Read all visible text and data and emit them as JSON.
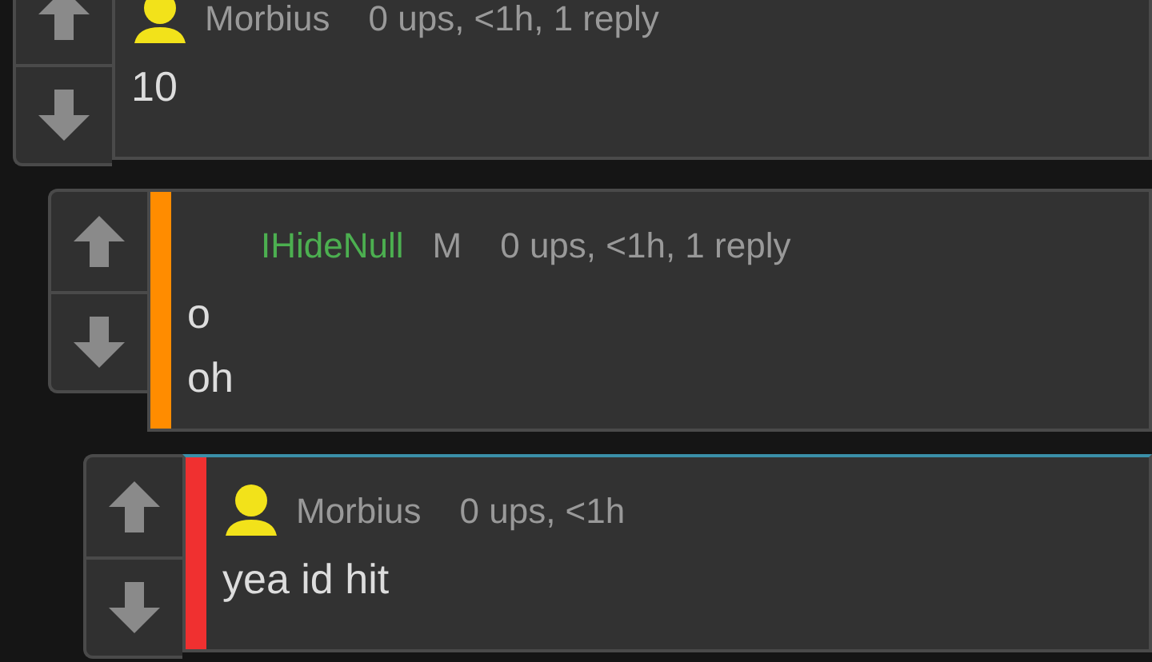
{
  "comments": [
    {
      "author": "Morbius",
      "author_highlighted": false,
      "avatar": true,
      "meta": "0 ups, <1h, 1 reply",
      "lines": [
        "10"
      ],
      "children": [
        {
          "author": "IHideNull",
          "author_highlighted": true,
          "avatar": false,
          "badge": "M",
          "meta": "0 ups, <1h, 1 reply",
          "lines": [
            "o",
            "oh"
          ],
          "color": "#ff8c00",
          "highlighted": false,
          "children": [
            {
              "author": "Morbius",
              "author_highlighted": false,
              "avatar": true,
              "meta": "0 ups, <1h",
              "lines": [
                "yea id hit"
              ],
              "color": "#f03030",
              "highlighted": true
            }
          ]
        }
      ]
    }
  ]
}
